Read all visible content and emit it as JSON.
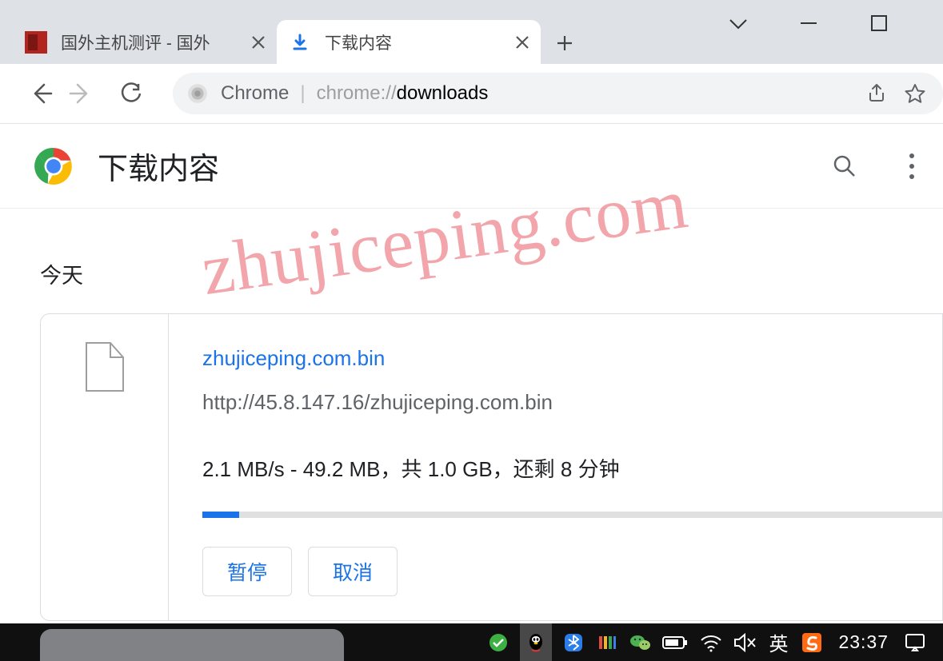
{
  "tabs": {
    "inactive_title": "国外主机测评 - 国外",
    "active_title": "下载内容"
  },
  "omnibox": {
    "label": "Chrome",
    "url_prefix": "chrome://",
    "url_bold": "downloads"
  },
  "page": {
    "header_title": "下载内容",
    "section_today": "今天"
  },
  "download": {
    "filename": "zhujiceping.com.bin",
    "source": "http://45.8.147.16/zhujiceping.com.bin",
    "status": "2.1 MB/s - 49.2 MB，共 1.0 GB，还剩 8 分钟",
    "progress_percent": 5,
    "pause_label": "暂停",
    "cancel_label": "取消"
  },
  "taskbar": {
    "ime": "英",
    "clock": "23:37"
  },
  "watermark": "zhujiceping.com"
}
